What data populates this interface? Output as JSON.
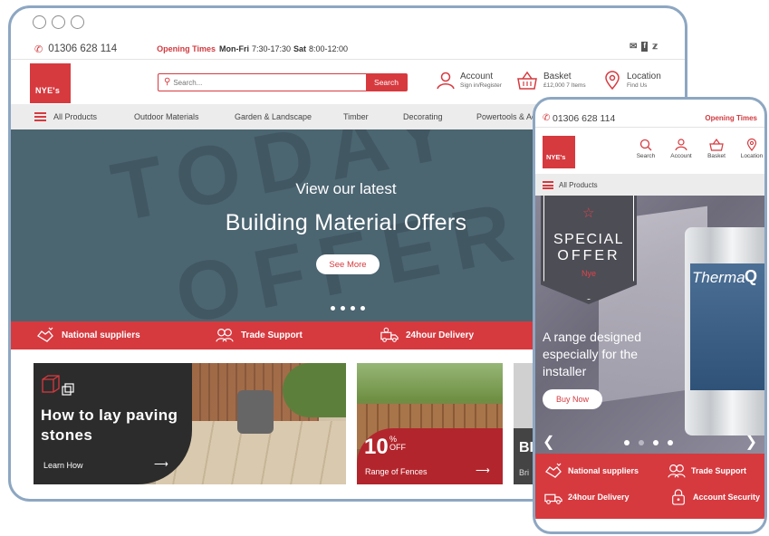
{
  "desktop": {
    "topbar": {
      "phone": "01306 628 114",
      "opening_label": "Opening Times",
      "weekday_label": "Mon-Fri",
      "weekday_time": "7:30-17:30",
      "sat_label": "Sat",
      "sat_time": "8:00-12:00"
    },
    "logo_text": "NYE's",
    "search": {
      "placeholder": "Search...",
      "button": "Search"
    },
    "account": {
      "title": "Account",
      "sub": "Sign in/Register"
    },
    "basket": {
      "title": "Basket",
      "sub": "£12,000 7 Items"
    },
    "location": {
      "title": "Location",
      "sub": "Find Us"
    },
    "nav": {
      "all_products": "All Products",
      "items": [
        "Outdoor Materials",
        "Garden & Landscape",
        "Timber",
        "Decorating",
        "Powertools & Acc"
      ]
    },
    "hero": {
      "ghost_line1": "TODAY",
      "ghost_line2": "OFFER",
      "line1": "View our latest",
      "line2": "Building Material Offers",
      "button": "See More"
    },
    "features": [
      "National suppliers",
      "Trade Support",
      "24hour Delivery"
    ],
    "card_paving": {
      "title": "How to lay paving stones",
      "link": "Learn How",
      "arrow": "⟶"
    },
    "card_fences": {
      "percent": "10",
      "percent_sign": "%",
      "off": "OFF",
      "text": "Range of Fences",
      "arrow": "⟶"
    },
    "card_third": {
      "title": "BI",
      "sub": "Bri"
    }
  },
  "mobile": {
    "phone": "01306 628 114",
    "opening_label": "Opening Times",
    "logo_text": "NYE's",
    "icons": [
      {
        "label": "Search",
        "icon": "search-icon"
      },
      {
        "label": "Account",
        "icon": "account-icon"
      },
      {
        "label": "Basket",
        "icon": "basket-icon"
      },
      {
        "label": "Location",
        "icon": "location-icon"
      }
    ],
    "all_products": "All Products",
    "badge": {
      "line1": "SPECIAL",
      "line2": "OFFER",
      "brand": "Nye"
    },
    "product_name": "Therma",
    "product_suffix": "Q",
    "headline": "A range designed especially for the installer",
    "button": "Buy Now",
    "features": [
      "National suppliers",
      "Trade Support",
      "24hour Delivery",
      "Account Security"
    ]
  },
  "colors": {
    "brand_red": "#d63a3f",
    "hero_teal": "#4b6571",
    "frame_blue": "#8da7c2"
  }
}
